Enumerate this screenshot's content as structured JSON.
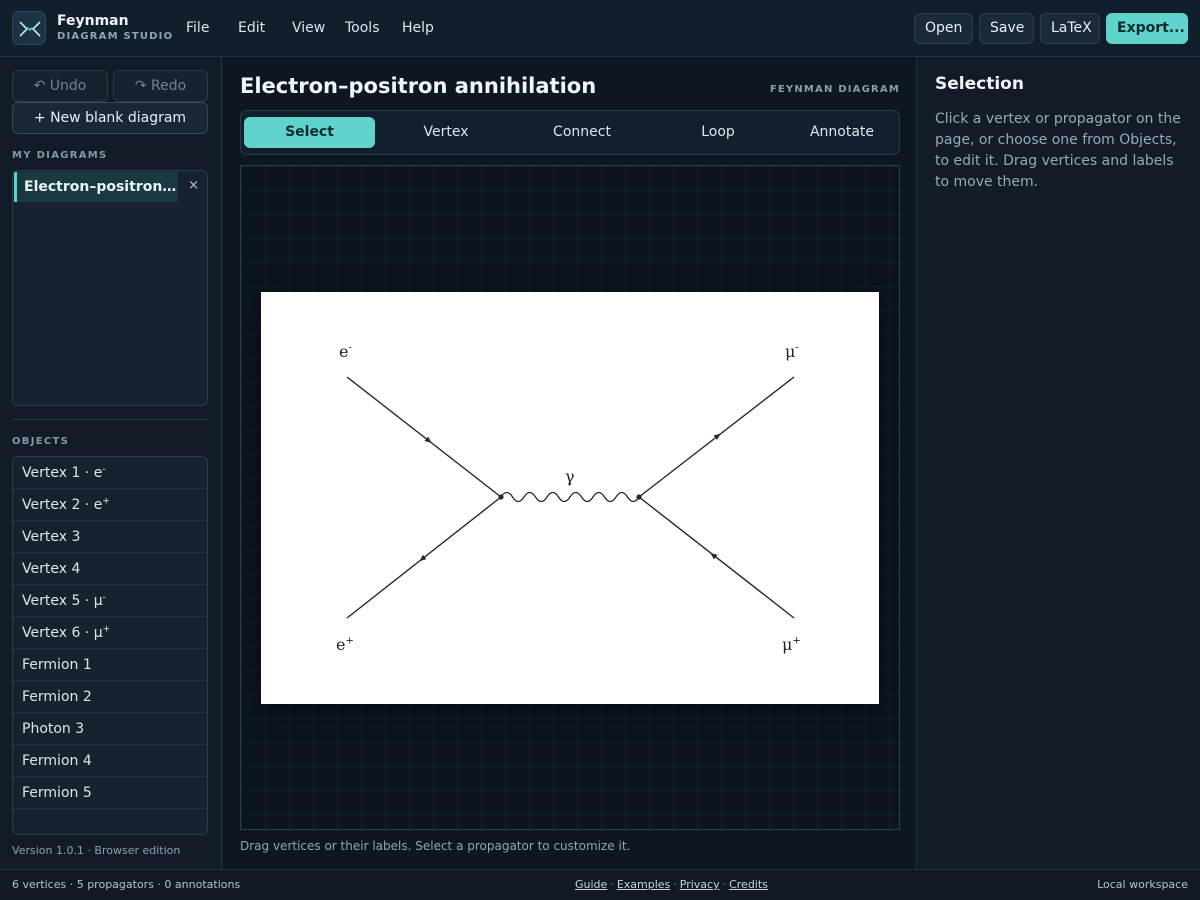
{
  "app": {
    "name": "Feynman",
    "subtitle": "DIAGRAM STUDIO"
  },
  "menu": [
    "File",
    "Edit",
    "View",
    "Tools",
    "Help"
  ],
  "toolbar_buttons": {
    "open": "Open",
    "save": "Save",
    "latex": "LaTeX",
    "export": "Export..."
  },
  "sidebar": {
    "undo": "Undo",
    "redo": "Redo",
    "new_blank": "+ New blank diagram",
    "my_diagrams_label": "MY DIAGRAMS",
    "diagrams": [
      {
        "name": "Electron–positron annihilation",
        "close": "×"
      }
    ],
    "objects_label": "OBJECTS",
    "objects": [
      {
        "label": "Vertex 1 · e",
        "sup": "-"
      },
      {
        "label": "Vertex 2 · e",
        "sup": "+"
      },
      {
        "label": "Vertex 3",
        "sup": ""
      },
      {
        "label": "Vertex 4",
        "sup": ""
      },
      {
        "label": "Vertex 5 · μ",
        "sup": "-"
      },
      {
        "label": "Vertex 6 · μ",
        "sup": "+"
      },
      {
        "label": "Fermion 1",
        "sup": ""
      },
      {
        "label": "Fermion 2",
        "sup": ""
      },
      {
        "label": "Photon 3",
        "sup": ""
      },
      {
        "label": "Fermion 4",
        "sup": ""
      },
      {
        "label": "Fermion 5",
        "sup": ""
      }
    ],
    "version": "Version 1.0.1 · Browser edition"
  },
  "main": {
    "title": "Electron–positron annihilation",
    "tag": "FEYNMAN DIAGRAM",
    "tools": [
      "Select",
      "Vertex",
      "Connect",
      "Loop",
      "Annotate"
    ],
    "active_tool": "Select",
    "hint": "Drag vertices or their labels. Select a propagator to customize it."
  },
  "diagram": {
    "labels": {
      "e_minus": {
        "base": "e",
        "sup": "-"
      },
      "e_plus": {
        "base": "e",
        "sup": "+"
      },
      "mu_minus": {
        "base": "μ",
        "sup": "-"
      },
      "mu_plus": {
        "base": "μ",
        "sup": "+"
      },
      "photon": {
        "base": "γ",
        "sup": ""
      }
    }
  },
  "right_panel": {
    "title": "Selection",
    "body": "Click a vertex or propagator on the page, or choose one from Objects, to edit it. Drag vertices and labels to move them."
  },
  "status": {
    "counts": "6 vertices · 5 propagators · 0 annotations",
    "links": [
      "Guide",
      "Examples",
      "Privacy",
      "Credits"
    ],
    "workspace": "Local workspace"
  },
  "colors": {
    "accent": "#5fd3cc",
    "background": "#0f1a26",
    "paper": "#ffffff"
  }
}
